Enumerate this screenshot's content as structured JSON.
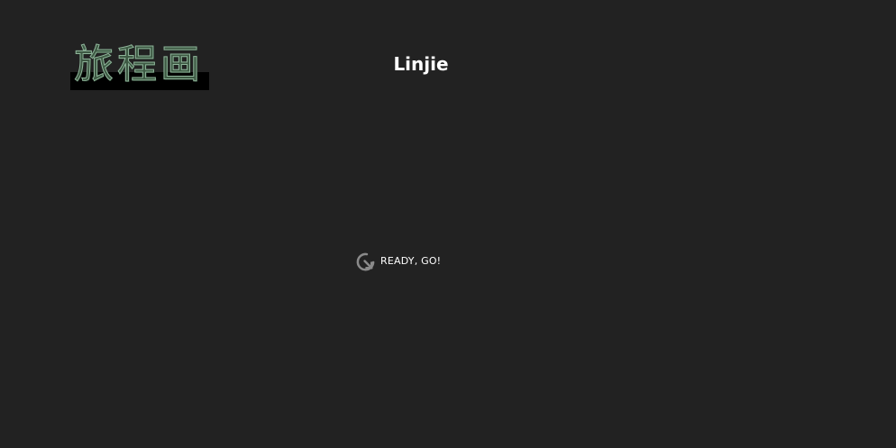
{
  "header": {
    "logo_text": "旅程画",
    "title": "Linjie"
  },
  "loader": {
    "icon": "refresh-icon",
    "label": "READY, GO!"
  },
  "colors": {
    "background": "#222222",
    "title_text": "#ffffff",
    "logo_green": "#3e5a44"
  }
}
